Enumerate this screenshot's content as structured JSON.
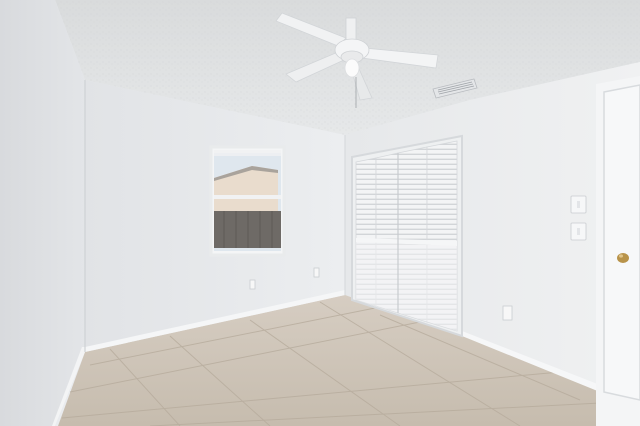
{
  "scene": {
    "description_type": "photo",
    "colors": {
      "ceiling": "#dfe1e2",
      "back_wall": "#e8eaec",
      "left_wall": "#e2e4e7",
      "right_wall": "#eceef0",
      "floor": "#cfc6bb",
      "grout": "#b9ae9f",
      "trim": "#f4f5f6",
      "closet_door": "#f2f3f4",
      "fan": "#f1f2f3",
      "window_sky": "#dfe7ee",
      "fence": "#6e6a66",
      "doorknob": "#b8934a"
    },
    "objects": [
      "ceiling-fan",
      "air-vent",
      "window",
      "closet-bifold-doors",
      "light-switch",
      "entry-door",
      "tile-floor",
      "outlets"
    ]
  }
}
